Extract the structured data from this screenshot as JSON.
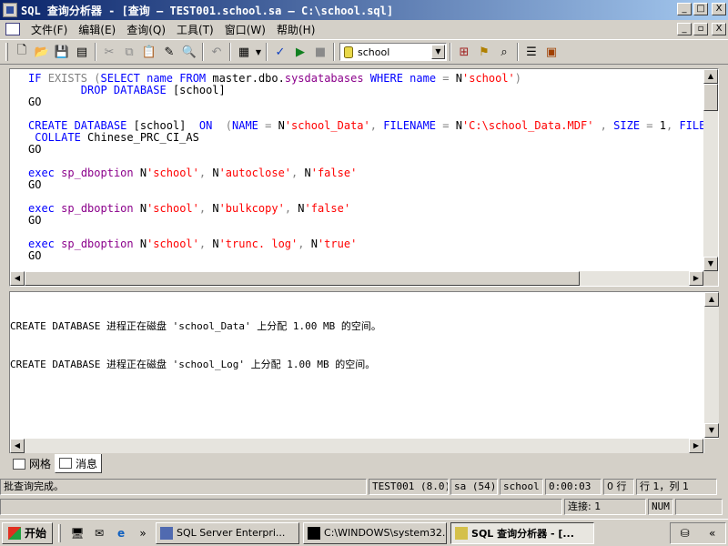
{
  "window": {
    "title": "SQL 查询分析器 - [查询 — TEST001.school.sa — C:\\school.sql]",
    "minimize": "_",
    "maximize": "□",
    "close": "X"
  },
  "menu": {
    "items": [
      "文件(F)",
      "编辑(E)",
      "查询(Q)",
      "工具(T)",
      "窗口(W)",
      "帮助(H)"
    ],
    "mdi_minimize": "_",
    "mdi_restore": "▫",
    "mdi_close": "X"
  },
  "toolbar": {
    "database": "school"
  },
  "editor": {
    "lines": [
      [
        {
          "c": "kw",
          "t": "IF "
        },
        {
          "c": "gray",
          "t": "EXISTS"
        },
        {
          "c": "",
          "t": " "
        },
        {
          "c": "gray",
          "t": "("
        },
        {
          "c": "kw",
          "t": "SELECT"
        },
        {
          "c": "",
          "t": " "
        },
        {
          "c": "kw",
          "t": "name"
        },
        {
          "c": "",
          "t": " "
        },
        {
          "c": "kw",
          "t": "FROM"
        },
        {
          "c": "",
          "t": " master.dbo."
        },
        {
          "c": "fn",
          "t": "sysdatabases"
        },
        {
          "c": "",
          "t": " "
        },
        {
          "c": "kw",
          "t": "WHERE"
        },
        {
          "c": "",
          "t": " "
        },
        {
          "c": "kw",
          "t": "name"
        },
        {
          "c": "",
          "t": " "
        },
        {
          "c": "gray",
          "t": "="
        },
        {
          "c": "",
          "t": " N"
        },
        {
          "c": "str",
          "t": "'school'"
        },
        {
          "c": "gray",
          "t": ")"
        }
      ],
      [
        {
          "c": "",
          "t": "        "
        },
        {
          "c": "kw",
          "t": "DROP DATABASE"
        },
        {
          "c": "",
          "t": " [school]"
        }
      ],
      [
        {
          "c": "",
          "t": "GO"
        }
      ],
      [
        {
          "c": "",
          "t": ""
        }
      ],
      [
        {
          "c": "kw",
          "t": "CREATE DATABASE"
        },
        {
          "c": "",
          "t": " [school]  "
        },
        {
          "c": "kw",
          "t": "ON"
        },
        {
          "c": "",
          "t": "  "
        },
        {
          "c": "gray",
          "t": "("
        },
        {
          "c": "kw",
          "t": "NAME"
        },
        {
          "c": "",
          "t": " "
        },
        {
          "c": "gray",
          "t": "="
        },
        {
          "c": "",
          "t": " N"
        },
        {
          "c": "str",
          "t": "'school_Data'"
        },
        {
          "c": "gray",
          "t": ","
        },
        {
          "c": "",
          "t": " "
        },
        {
          "c": "kw",
          "t": "FILENAME"
        },
        {
          "c": "",
          "t": " "
        },
        {
          "c": "gray",
          "t": "="
        },
        {
          "c": "",
          "t": " N"
        },
        {
          "c": "str",
          "t": "'C:\\school_Data.MDF'"
        },
        {
          "c": "",
          "t": " "
        },
        {
          "c": "gray",
          "t": ","
        },
        {
          "c": "",
          "t": " "
        },
        {
          "c": "kw",
          "t": "SIZE"
        },
        {
          "c": "",
          "t": " "
        },
        {
          "c": "gray",
          "t": "="
        },
        {
          "c": "",
          "t": " 1"
        },
        {
          "c": "gray",
          "t": ","
        },
        {
          "c": "",
          "t": " "
        },
        {
          "c": "kw",
          "t": "FILEGROWTH"
        }
      ],
      [
        {
          "c": "",
          "t": " "
        },
        {
          "c": "kw",
          "t": "COLLATE"
        },
        {
          "c": "",
          "t": " Chinese_PRC_CI_AS"
        }
      ],
      [
        {
          "c": "",
          "t": "GO"
        }
      ],
      [
        {
          "c": "",
          "t": ""
        }
      ],
      [
        {
          "c": "kw",
          "t": "exec"
        },
        {
          "c": "",
          "t": " "
        },
        {
          "c": "fn",
          "t": "sp_dboption"
        },
        {
          "c": "",
          "t": " N"
        },
        {
          "c": "str",
          "t": "'school'"
        },
        {
          "c": "gray",
          "t": ","
        },
        {
          "c": "",
          "t": " N"
        },
        {
          "c": "str",
          "t": "'autoclose'"
        },
        {
          "c": "gray",
          "t": ","
        },
        {
          "c": "",
          "t": " N"
        },
        {
          "c": "str",
          "t": "'false'"
        }
      ],
      [
        {
          "c": "",
          "t": "GO"
        }
      ],
      [
        {
          "c": "",
          "t": ""
        }
      ],
      [
        {
          "c": "kw",
          "t": "exec"
        },
        {
          "c": "",
          "t": " "
        },
        {
          "c": "fn",
          "t": "sp_dboption"
        },
        {
          "c": "",
          "t": " N"
        },
        {
          "c": "str",
          "t": "'school'"
        },
        {
          "c": "gray",
          "t": ","
        },
        {
          "c": "",
          "t": " N"
        },
        {
          "c": "str",
          "t": "'bulkcopy'"
        },
        {
          "c": "gray",
          "t": ","
        },
        {
          "c": "",
          "t": " N"
        },
        {
          "c": "str",
          "t": "'false'"
        }
      ],
      [
        {
          "c": "",
          "t": "GO"
        }
      ],
      [
        {
          "c": "",
          "t": ""
        }
      ],
      [
        {
          "c": "kw",
          "t": "exec"
        },
        {
          "c": "",
          "t": " "
        },
        {
          "c": "fn",
          "t": "sp_dboption"
        },
        {
          "c": "",
          "t": " N"
        },
        {
          "c": "str",
          "t": "'school'"
        },
        {
          "c": "gray",
          "t": ","
        },
        {
          "c": "",
          "t": " N"
        },
        {
          "c": "str",
          "t": "'trunc. log'"
        },
        {
          "c": "gray",
          "t": ","
        },
        {
          "c": "",
          "t": " N"
        },
        {
          "c": "str",
          "t": "'true'"
        }
      ],
      [
        {
          "c": "",
          "t": "GO"
        }
      ]
    ]
  },
  "messages": [
    "CREATE DATABASE 进程正在磁盘 'school_Data' 上分配 1.00 MB 的空间。",
    "CREATE DATABASE 进程正在磁盘 'school_Log' 上分配 1.00 MB 的空间。"
  ],
  "result_tabs": [
    "网格",
    "消息"
  ],
  "status": {
    "message": "批查询完成。",
    "server": "TEST001 (8.0)",
    "user": "sa (54)",
    "database": "school",
    "elapsed": "0:00:03",
    "rows": "0 行",
    "position": "行 1，列 1",
    "connections": "连接: 1",
    "numlock": "NUM"
  },
  "taskbar": {
    "start": "开始",
    "more": "»",
    "tasks": [
      "SQL Server Enterpri...",
      "C:\\WINDOWS\\system32...",
      "SQL 查询分析器 - [..."
    ],
    "tray_more": "«"
  }
}
